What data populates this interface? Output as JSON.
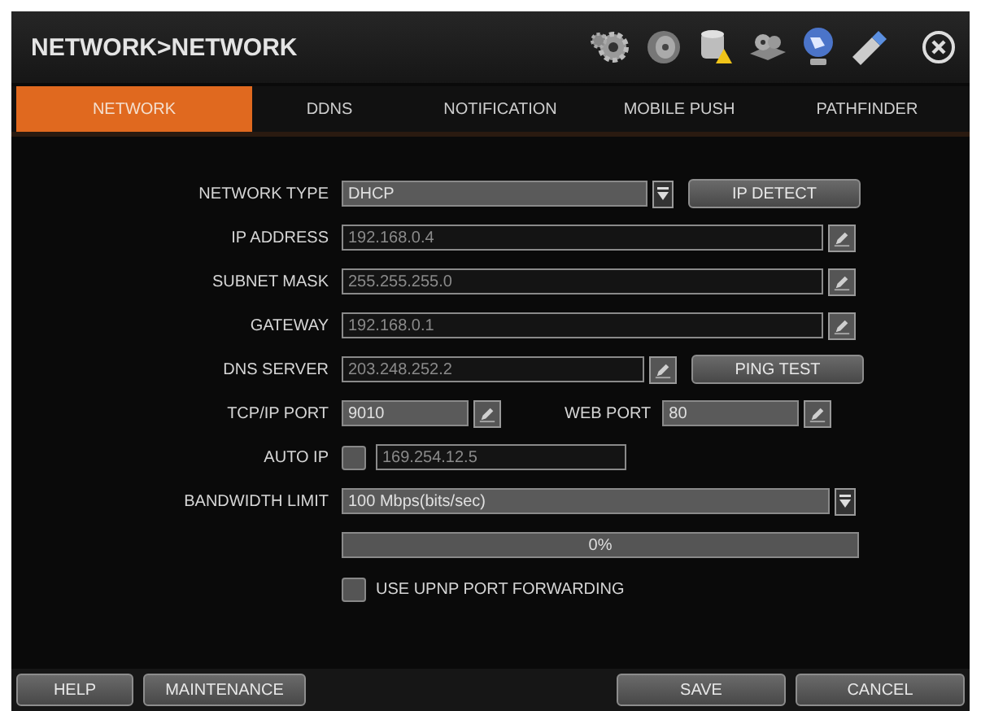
{
  "window": {
    "title": "NETWORK>NETWORK"
  },
  "tabs": [
    {
      "label": "NETWORK",
      "selected": true
    },
    {
      "label": "DDNS",
      "selected": false
    },
    {
      "label": "NOTIFICATION",
      "selected": false
    },
    {
      "label": "MOBILE PUSH",
      "selected": false
    },
    {
      "label": "PATHFINDER",
      "selected": false
    }
  ],
  "form": [
    {
      "kind": "select",
      "label": "NETWORK TYPE",
      "value": "DHCP",
      "button": "IP DETECT"
    },
    {
      "kind": "text",
      "label": "IP ADDRESS",
      "value": "192.168.0.4",
      "disabled": true
    },
    {
      "kind": "text",
      "label": "SUBNET MASK",
      "value": "255.255.255.0",
      "disabled": true
    },
    {
      "kind": "text",
      "label": "GATEWAY",
      "value": "192.168.0.1",
      "disabled": true
    },
    {
      "kind": "text",
      "label": "DNS SERVER",
      "value": "203.248.252.2",
      "disabled": true,
      "button": "PING TEST"
    },
    {
      "kind": "ports",
      "label": "TCP/IP PORT",
      "value": "9010",
      "label_2": "WEB PORT",
      "value_2": "80"
    },
    {
      "kind": "checkbox_text",
      "label": "AUTO IP",
      "checked": false,
      "value": "169.254.12.5"
    },
    {
      "kind": "select",
      "label": "BANDWIDTH LIMIT",
      "value": "100 Mbps(bits/sec)"
    },
    {
      "kind": "progress",
      "reading": "0%"
    },
    {
      "kind": "checkbox",
      "label": "USE UPNP PORT FORWARDING",
      "checked": false
    }
  ],
  "footer": {
    "left_buttons": [
      "HELP",
      "MAINTENANCE"
    ],
    "right_buttons": [
      "SAVE",
      "CANCEL"
    ]
  }
}
